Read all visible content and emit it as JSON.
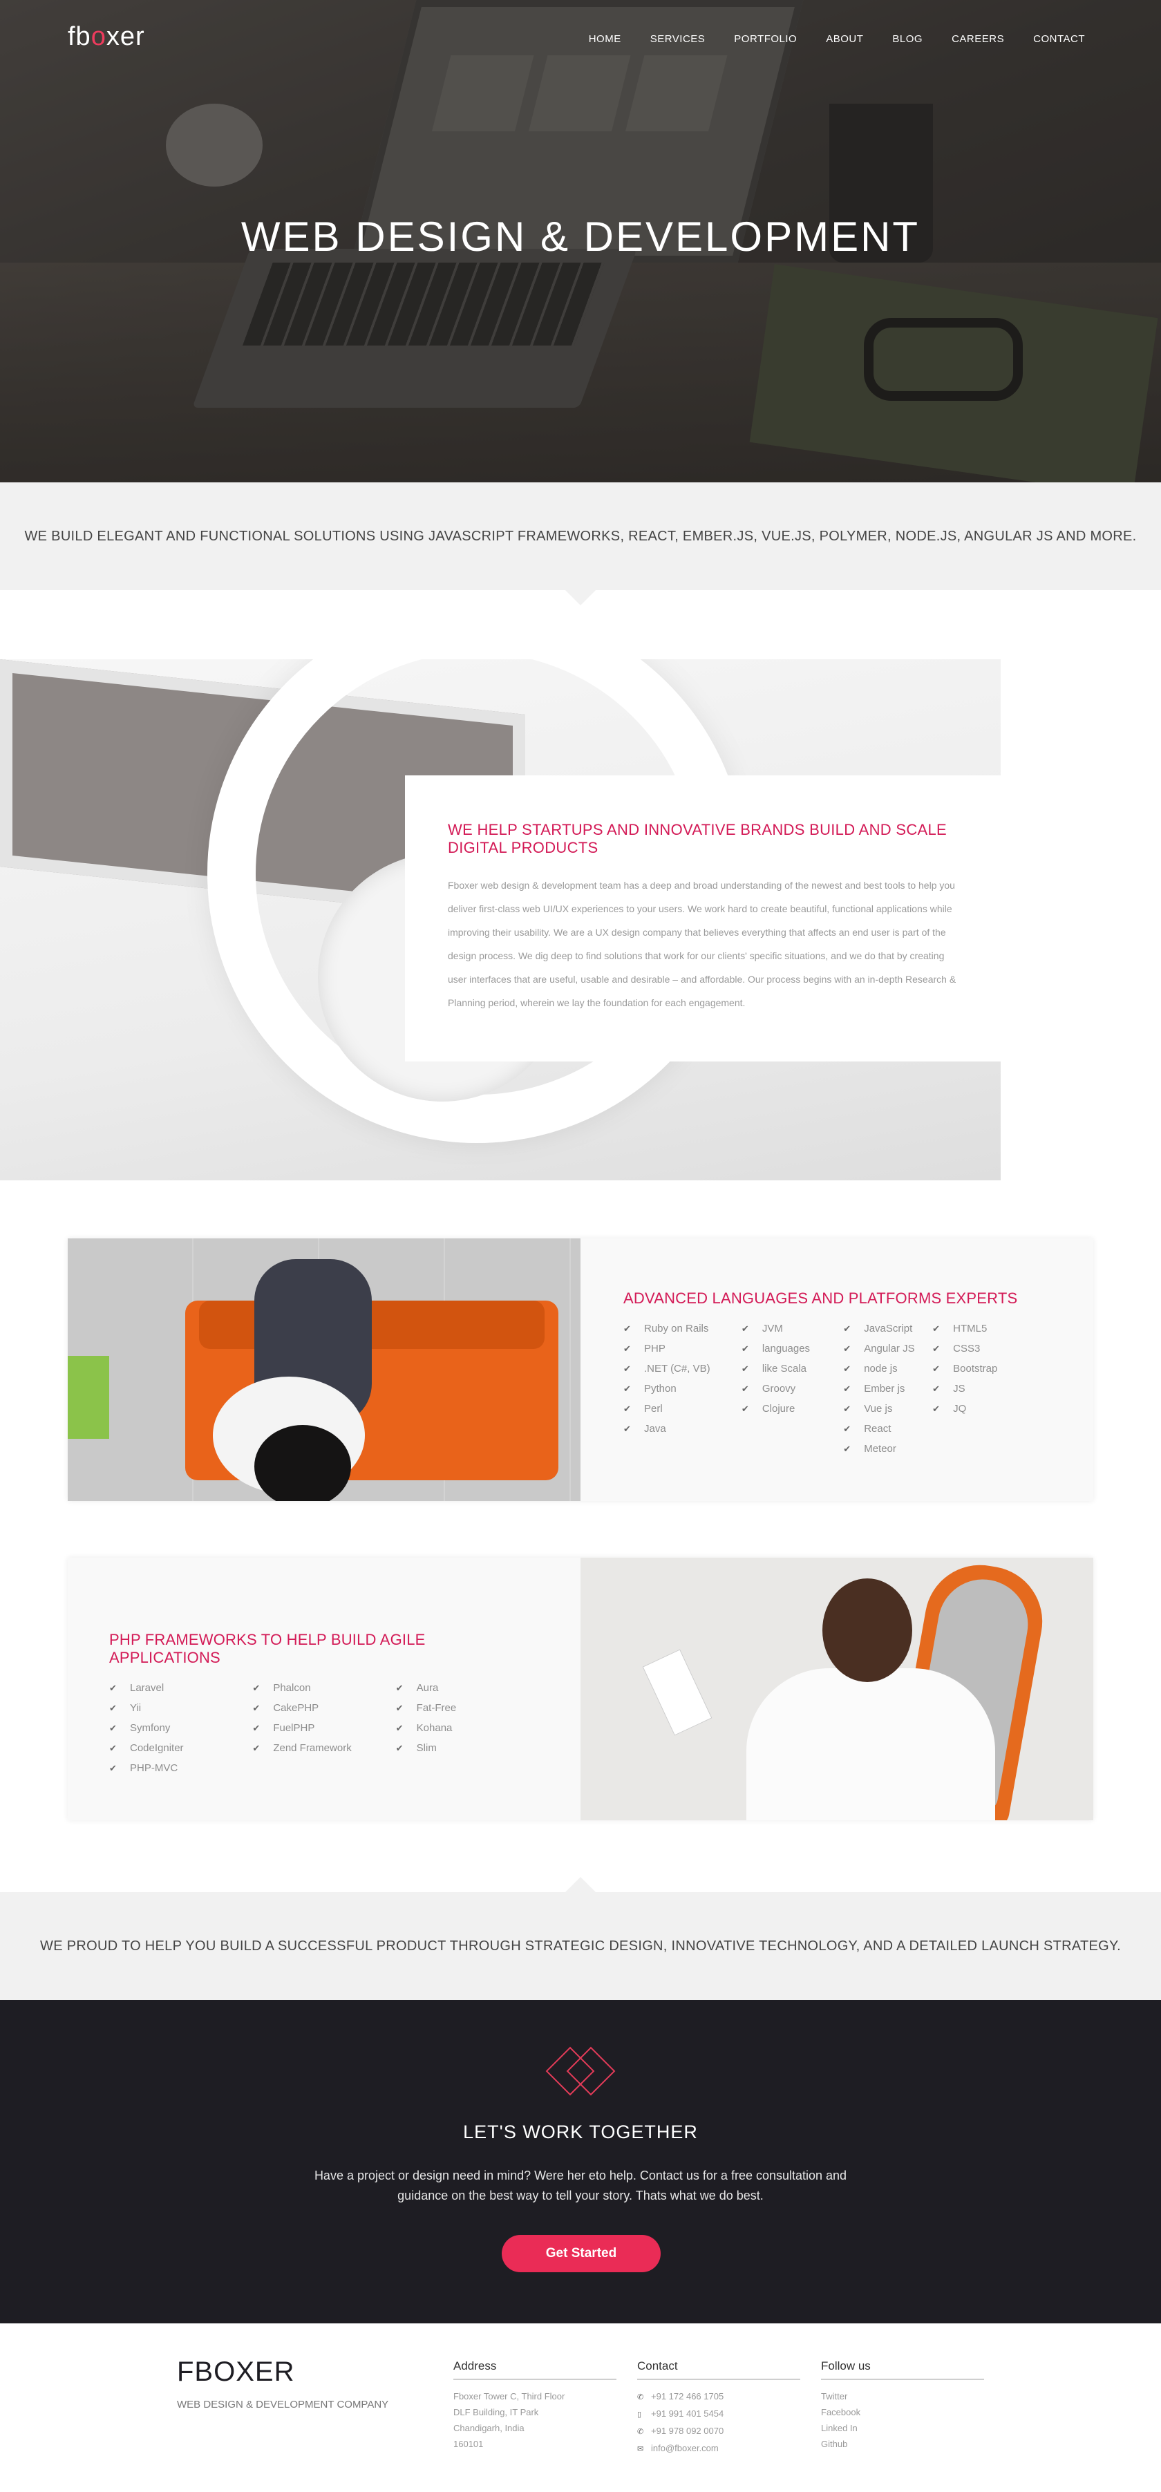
{
  "header": {
    "logo_prefix": "fb",
    "logo_o": "o",
    "logo_suffix": "xer",
    "nav": [
      "HOME",
      "SERVICES",
      "PORTFOLIO",
      "ABOUT",
      "BLOG",
      "CAREERS",
      "CONTACT"
    ]
  },
  "hero": {
    "title": "WEB DESIGN & DEVELOPMENT"
  },
  "tagline_top": "WE BUILD ELEGANT AND FUNCTIONAL SOLUTIONS USING JAVASCRIPT FRAMEWORKS, REACT, EMBER.JS, VUE.JS, POLYMER, NODE.JS, ANGULAR JS AND MORE.",
  "intro": {
    "heading": "WE HELP STARTUPS AND INNOVATIVE BRANDS BUILD AND SCALE DIGITAL PRODUCTS",
    "body": "Fboxer web design & development team has a deep and broad understanding of the newest and best tools to help you deliver first-class web UI/UX experiences to your users. We work hard to create beautiful, functional applications while improving their usability. We are a UX design company that believes everything that affects an end user is part of the design process. We dig deep to find solutions that work for our clients' specific situations, and we do that by creating user interfaces that are useful, usable and desirable – and affordable. Our process begins with an in-depth Research & Planning period, wherein we lay the foundation for each engagement."
  },
  "languages": {
    "heading": "ADVANCED LANGUAGES AND PLATFORMS EXPERTS",
    "columns": [
      [
        "Ruby on Rails",
        "PHP",
        ".NET (C#, VB)",
        "Python",
        "Perl",
        "Java"
      ],
      [
        "JVM",
        "languages",
        "like Scala",
        "Groovy",
        "Clojure"
      ],
      [
        "JavaScript",
        "Angular JS",
        "node js",
        "Ember js",
        "Vue js",
        "React",
        "Meteor"
      ],
      [
        "HTML5",
        "CSS3",
        "Bootstrap",
        "JS",
        "JQ"
      ]
    ]
  },
  "php": {
    "heading": "PHP FRAMEWORKS TO HELP BUILD AGILE APPLICATIONS",
    "columns": [
      [
        "Laravel",
        "Yii",
        "Symfony",
        "CodeIgniter",
        "PHP-MVC"
      ],
      [
        "Phalcon",
        "CakePHP",
        "FuelPHP",
        "Zend Framework"
      ],
      [
        "Aura",
        "Fat-Free",
        "Kohana",
        "Slim"
      ]
    ]
  },
  "tagline_bottom": "WE PROUD TO HELP YOU BUILD A SUCCESSFUL PRODUCT THROUGH STRATEGIC DESIGN, INNOVATIVE TECHNOLOGY, AND A DETAILED LAUNCH STRATEGY.",
  "cta": {
    "title": "LET'S WORK TOGETHER",
    "body": "Have a project or design need in mind? Were her eto help. Contact us for a free consultation and guidance on the best way to tell your story. Thats what we do best.",
    "button": "Get Started"
  },
  "footer": {
    "brand": "FBOXER",
    "tagline": "WEB DESIGN & DEVELOPMENT COMPANY",
    "address_heading": "Address",
    "address_lines": [
      "Fboxer Tower C, Third Floor",
      "DLF Building, IT Park",
      "Chandigarh, India",
      "160101"
    ],
    "contact_heading": "Contact",
    "contact_lines": [
      "+91 172 466 1705",
      "+91 991 401 5454",
      "+91 978 092 0070",
      "info@fboxer.com"
    ],
    "follow_heading": "Follow us",
    "follow_links": [
      "Twitter",
      "Facebook",
      "Linked In",
      "Github"
    ]
  },
  "colors": {
    "accent": "#d31a56",
    "button": "#ea2c56",
    "cta_bg": "#1e1d23",
    "band_bg": "#f1f1f1"
  },
  "icons": {
    "check": "check-icon",
    "phone": "phone-icon",
    "mobile": "mobile-icon",
    "email": "envelope-icon"
  }
}
